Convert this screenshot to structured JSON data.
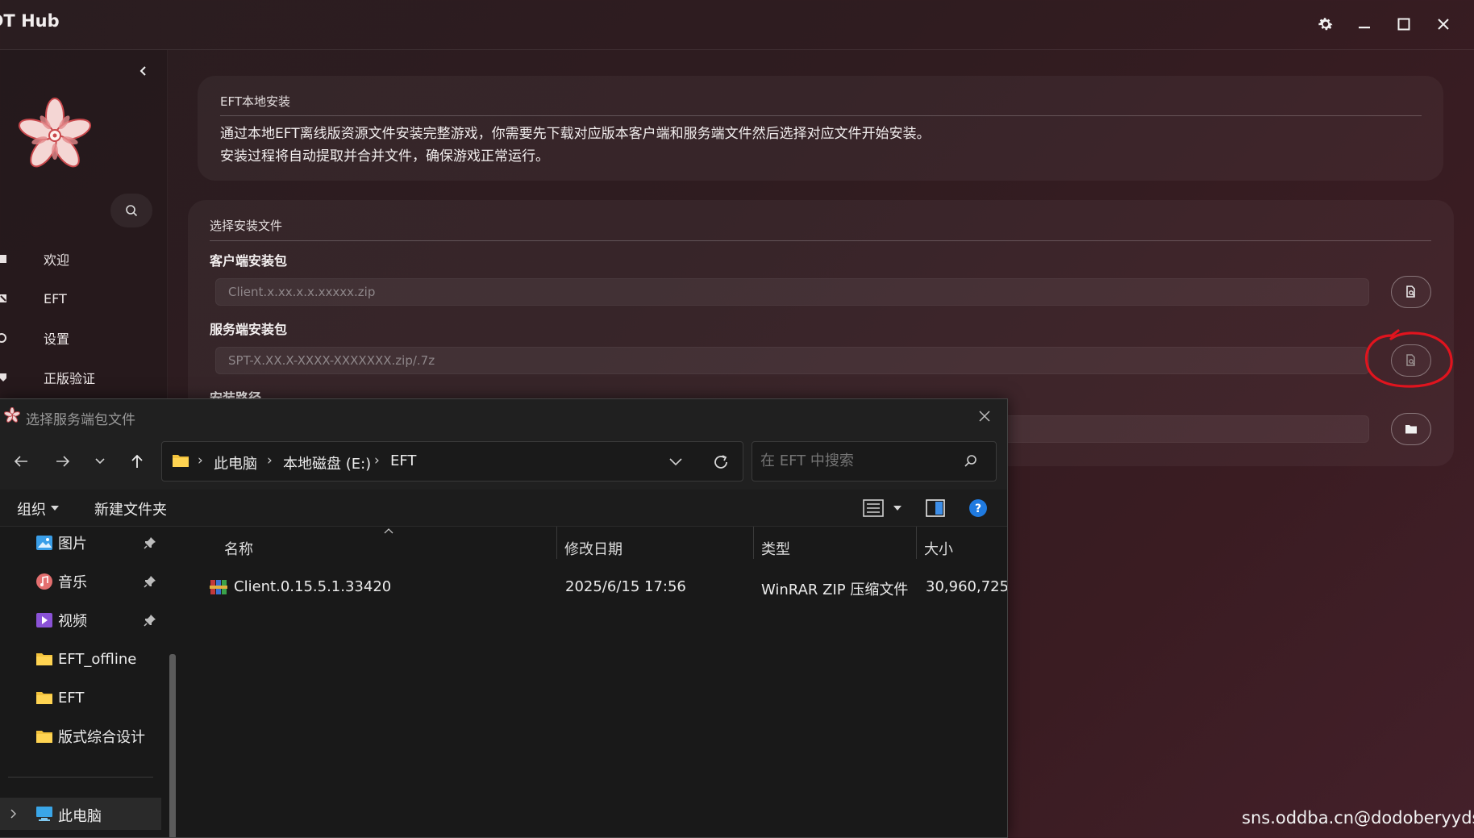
{
  "app": {
    "title": "DT Hub",
    "window_controls": [
      "settings-icon",
      "minimize-icon",
      "maximize-icon",
      "close-icon"
    ]
  },
  "sidebar": {
    "collapse_icon": "chevron-left-icon",
    "logo_icon": "flower-logo",
    "search_icon": "search-icon",
    "items": [
      {
        "label": "欢迎",
        "icon": "welcome-icon"
      },
      {
        "label": "EFT",
        "icon": "eft-icon"
      },
      {
        "label": "设置",
        "icon": "settings-icon"
      },
      {
        "label": "正版验证",
        "icon": "verify-icon"
      }
    ]
  },
  "intro_card": {
    "title": "EFT本地安装",
    "line1": "通过本地EFT离线版资源文件安装完整游戏，你需要先下载对应版本客户端和服务端文件然后选择对应文件开始安装。",
    "line2": "安装过程将自动提取并合并文件，确保游戏正常运行。"
  },
  "file_card": {
    "title": "选择安装文件",
    "client_label": "客户端安装包",
    "client_placeholder": "Client.x.xx.x.x.xxxxx.zip",
    "server_label": "服务端安装包",
    "server_placeholder": "SPT-X.XX.X-XXXX-XXXXXXX.zip/.7z",
    "path_label": "安装路径",
    "browse_icon": "file-search-icon",
    "folder_icon": "folder-icon"
  },
  "dialog": {
    "title": "选择服务端包文件",
    "breadcrumb": [
      "此电脑",
      "本地磁盘 (E:)",
      "EFT"
    ],
    "search_placeholder": "在 EFT 中搜索",
    "toolbar": {
      "organize": "组织",
      "new_folder": "新建文件夹"
    },
    "tree": [
      {
        "label": "图片",
        "icon": "pictures-icon",
        "pinned": true
      },
      {
        "label": "音乐",
        "icon": "music-icon",
        "pinned": true
      },
      {
        "label": "视频",
        "icon": "video-icon",
        "pinned": true
      },
      {
        "label": "EFT_offline",
        "icon": "folder-icon",
        "pinned": false
      },
      {
        "label": "EFT",
        "icon": "folder-icon",
        "pinned": false
      },
      {
        "label": "版式综合设计",
        "icon": "folder-icon",
        "pinned": false
      }
    ],
    "this_pc": "此电脑",
    "columns": {
      "name": "名称",
      "modified": "修改日期",
      "type": "类型",
      "size": "大小"
    },
    "files": [
      {
        "name": "Client.0.15.5.1.33420",
        "modified": "2025/6/15 17:56",
        "type": "WinRAR ZIP 压缩文件",
        "size": "30,960,725",
        "icon": "winrar-zip-icon"
      }
    ]
  },
  "watermark": "sns.oddba.cn@dodoberyyds",
  "colors": {
    "accent_red": "#e0141e",
    "background": "#2f1c20",
    "dialog_bg": "#191919"
  }
}
